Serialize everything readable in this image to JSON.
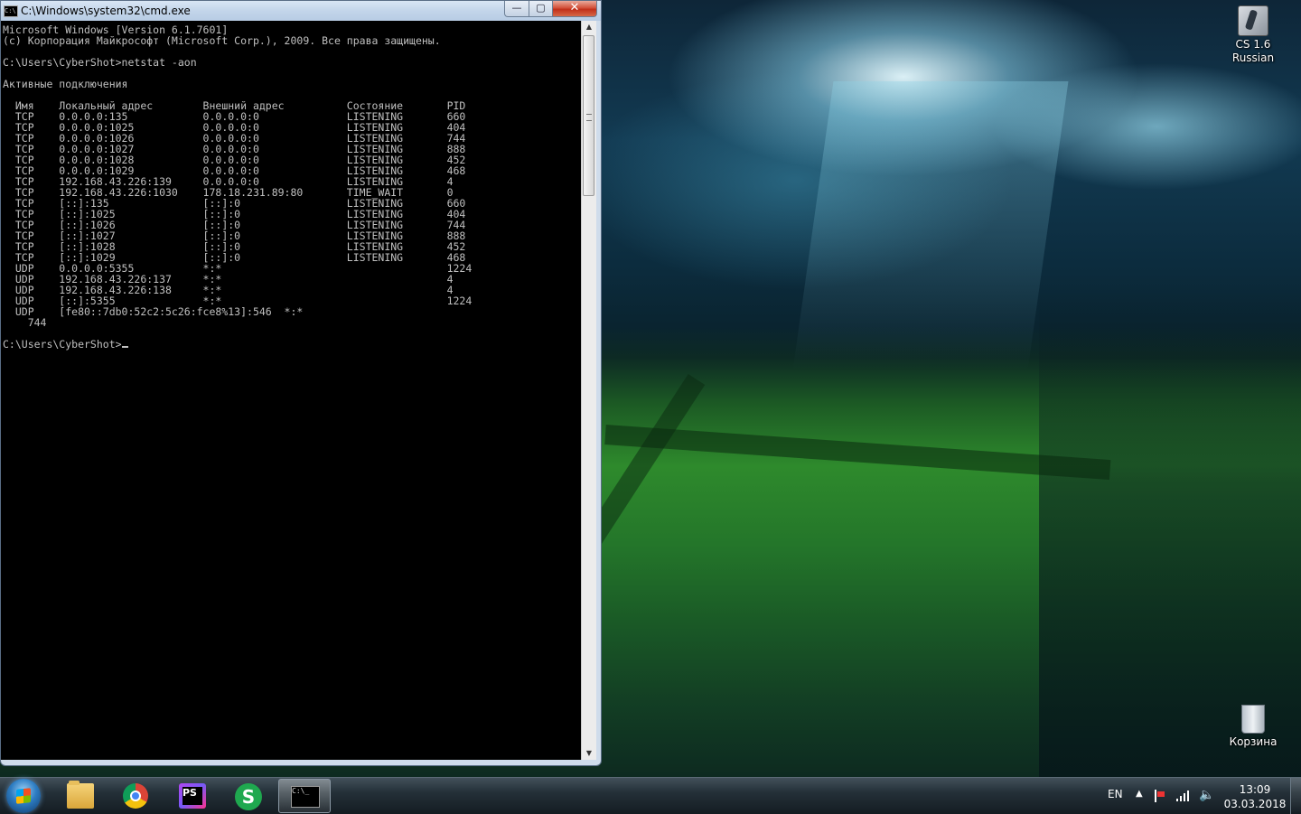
{
  "window": {
    "title": "C:\\Windows\\system32\\cmd.exe",
    "controls": {
      "minimize": "—",
      "maximize": "▢",
      "close": "✕"
    }
  },
  "console": {
    "lines": [
      "Microsoft Windows [Version 6.1.7601]",
      "(c) Корпорация Майкрософт (Microsoft Corp.), 2009. Все права защищены.",
      "",
      "C:\\Users\\CyberShot>netstat -aon",
      "",
      "Активные подключения",
      "",
      "  Имя    Локальный адрес        Внешний адрес          Состояние       PID",
      "  TCP    0.0.0.0:135            0.0.0.0:0              LISTENING       660",
      "  TCP    0.0.0.0:1025           0.0.0.0:0              LISTENING       404",
      "  TCP    0.0.0.0:1026           0.0.0.0:0              LISTENING       744",
      "  TCP    0.0.0.0:1027           0.0.0.0:0              LISTENING       888",
      "  TCP    0.0.0.0:1028           0.0.0.0:0              LISTENING       452",
      "  TCP    0.0.0.0:1029           0.0.0.0:0              LISTENING       468",
      "  TCP    192.168.43.226:139     0.0.0.0:0              LISTENING       4",
      "  TCP    192.168.43.226:1030    178.18.231.89:80       TIME_WAIT       0",
      "  TCP    [::]:135               [::]:0                 LISTENING       660",
      "  TCP    [::]:1025              [::]:0                 LISTENING       404",
      "  TCP    [::]:1026              [::]:0                 LISTENING       744",
      "  TCP    [::]:1027              [::]:0                 LISTENING       888",
      "  TCP    [::]:1028              [::]:0                 LISTENING       452",
      "  TCP    [::]:1029              [::]:0                 LISTENING       468",
      "  UDP    0.0.0.0:5355           *:*                                    1224",
      "  UDP    192.168.43.226:137     *:*                                    4",
      "  UDP    192.168.43.226:138     *:*                                    4",
      "  UDP    [::]:5355              *:*                                    1224",
      "  UDP    [fe80::7db0:52c2:5c26:fce8%13]:546  *:*",
      "    744",
      ""
    ],
    "prompt": "C:\\Users\\CyberShot>"
  },
  "desktop": {
    "icons": [
      {
        "label_line1": "CS 1.6",
        "label_line2": "Russian",
        "icon": "cs-icon"
      },
      {
        "label": "Корзина",
        "icon": "recycle-bin-icon"
      }
    ]
  },
  "taskbar": {
    "apps": [
      {
        "name": "explorer",
        "icon": "folder-icon"
      },
      {
        "name": "chrome",
        "icon": "chrome-icon"
      },
      {
        "name": "phpstorm",
        "label": "PS",
        "icon": "phpstorm-icon"
      },
      {
        "name": "skype-s",
        "label": "S",
        "icon": "s-app-icon"
      },
      {
        "name": "cmd",
        "label": "C:\\_",
        "icon": "cmd-icon"
      }
    ],
    "tray": {
      "language": "EN",
      "arrow": "▲",
      "volume_glyph": "🔈",
      "time": "13:09",
      "date": "03.03.2018"
    }
  }
}
